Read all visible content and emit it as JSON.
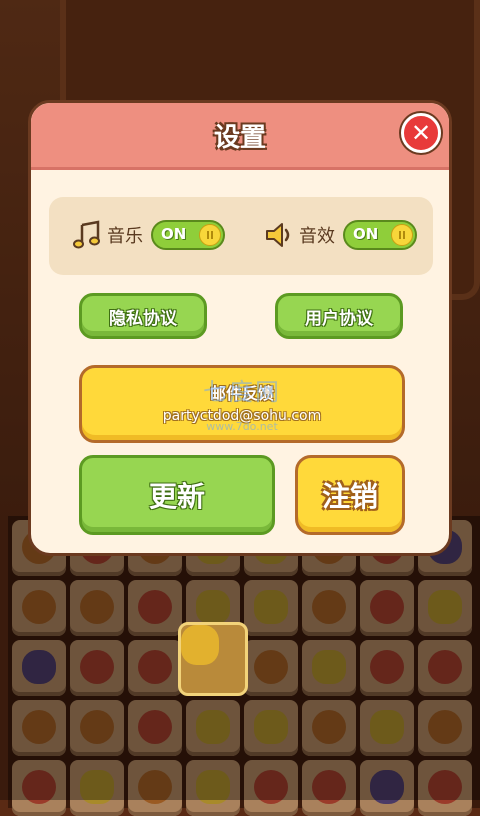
{
  "dialog": {
    "title": "设置",
    "close_icon": "close-icon"
  },
  "sound": {
    "music_label": "音乐",
    "music_icon": "music-note-icon",
    "music_state": "ON",
    "sfx_label": "音效",
    "sfx_icon": "speaker-icon",
    "sfx_state": "ON"
  },
  "buttons": {
    "privacy": "隐私协议",
    "user_agreement": "用户协议",
    "feedback_title": "邮件反馈",
    "feedback_email": "partyctdod@sohu.com",
    "update": "更新",
    "logout": "注销"
  },
  "watermark": {
    "text": "七度网",
    "sub": "www.7do.net"
  },
  "colors": {
    "header": "#ee8f80",
    "panel": "#fff3e2",
    "green": "#97d651",
    "yellow": "#ffd93a",
    "close": "#e83a3a"
  }
}
